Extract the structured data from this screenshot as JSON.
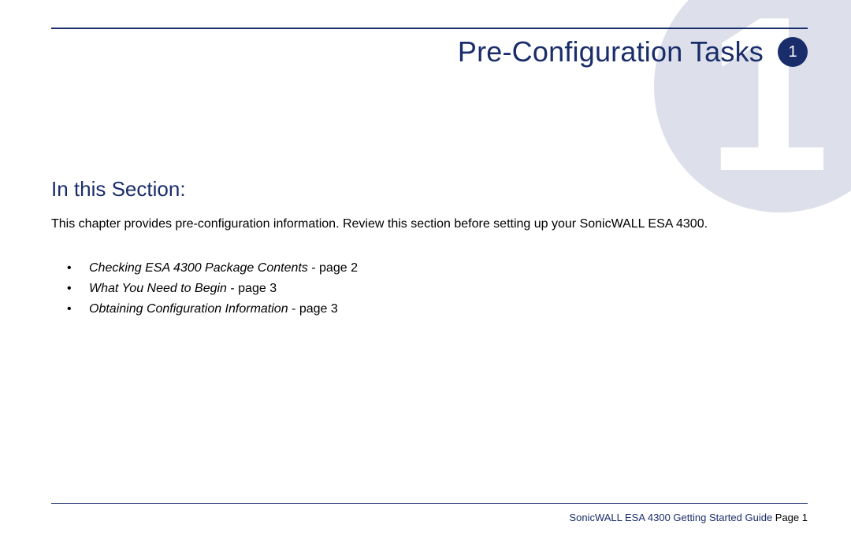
{
  "watermark": {
    "number": "1"
  },
  "header": {
    "title": "Pre-Configuration Tasks",
    "badge": "1"
  },
  "section": {
    "heading": "In this Section:",
    "intro": "This chapter provides pre-configuration information. Review this section before setting up your SonicWALL ESA 4300."
  },
  "toc": [
    {
      "title": "Checking ESA 4300 Package Contents",
      "page_ref": " - page 2"
    },
    {
      "title": "What You Need to Begin",
      "page_ref": " - page 3"
    },
    {
      "title": "Obtaining Configuration Information",
      "page_ref": " - page 3"
    }
  ],
  "footer": {
    "guide": "SonicWALL ESA 4300 Getting Started Guide",
    "page_label": "  Page 1"
  }
}
